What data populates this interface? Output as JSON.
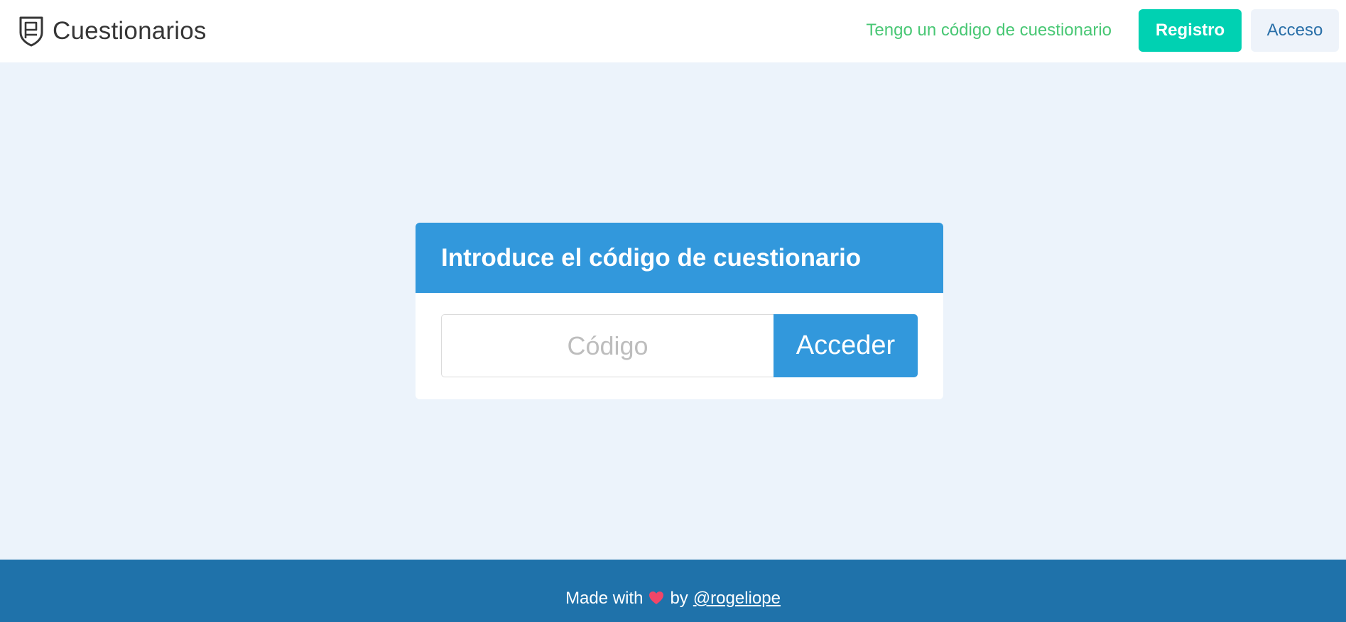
{
  "navbar": {
    "brand_icon": "shield-logo-icon",
    "brand_title": "Cuestionarios",
    "code_link": "Tengo un código de cuestionario",
    "register_label": "Registro",
    "login_label": "Acceso"
  },
  "card": {
    "title": "Introduce el código de cuestionario",
    "input_placeholder": "Código",
    "input_value": "",
    "submit_label": "Acceder"
  },
  "footer": {
    "prefix": "Made with",
    "heart_icon": "heart-icon",
    "middle": "by",
    "author_link": "@rogeliope"
  },
  "colors": {
    "accent_blue": "#3298dc",
    "primary_teal": "#00d1b2",
    "success_green": "#48c774",
    "footer_blue": "#1f72aa",
    "background": "#ecf3fb",
    "heart_red": "#f14668"
  }
}
